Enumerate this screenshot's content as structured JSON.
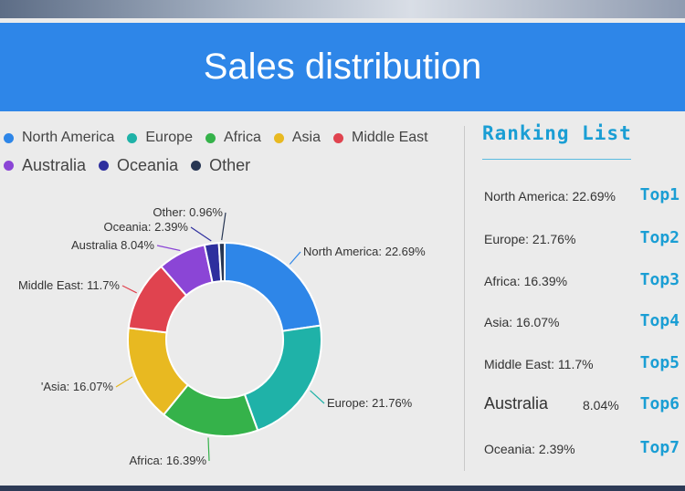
{
  "header": {
    "title": "Sales distribution"
  },
  "legend": {
    "row1": [
      {
        "name": "North America",
        "color": "#2e86e8"
      },
      {
        "name": "Europe",
        "color": "#1fb2a8"
      },
      {
        "name": "Africa",
        "color": "#35b24a"
      },
      {
        "name": "Asia",
        "color": "#e8b921"
      },
      {
        "name": "Middle East",
        "color": "#e0434f"
      }
    ],
    "row2": [
      {
        "name": "Australia",
        "color": "#8b45d6"
      },
      {
        "name": "Oceania",
        "color": "#2e2f9e"
      },
      {
        "name": "Other",
        "color": "#273653"
      }
    ]
  },
  "chart_data": {
    "type": "pie",
    "donut": true,
    "slices": [
      {
        "label": "North America",
        "value": 22.69,
        "display": "North America: 22.69%",
        "color": "#2e86e8"
      },
      {
        "label": "Europe",
        "value": 21.76,
        "display": "Europe: 21.76%",
        "color": "#1fb2a8"
      },
      {
        "label": "Africa",
        "value": 16.39,
        "display": "Africa: 16.39%",
        "color": "#35b24a"
      },
      {
        "label": "Asia",
        "value": 16.07,
        "display": "'Asia: 16.07%",
        "color": "#e8b921"
      },
      {
        "label": "Middle East",
        "value": 11.7,
        "display": "Middle East: 11.7%",
        "color": "#e0434f"
      },
      {
        "label": "Australia",
        "value": 8.04,
        "display": "Australia 8.04%",
        "color": "#8b45d6"
      },
      {
        "label": "Oceania",
        "value": 2.39,
        "display": "Oceania: 2.39%",
        "color": "#2e2f9e"
      },
      {
        "label": "Other",
        "value": 0.96,
        "display": "Other: 0.96%",
        "color": "#273653"
      }
    ]
  },
  "ranking": {
    "title": "Ranking List",
    "items": [
      {
        "text": "North America: 22.69%",
        "badge": "Top1"
      },
      {
        "text": "Europe: 21.76%",
        "badge": "Top2"
      },
      {
        "text": "Africa: 16.39%",
        "badge": "Top3"
      },
      {
        "text": "Asia: 16.07%",
        "badge": "Top4"
      },
      {
        "text": "Middle East: 11.7%",
        "badge": "Top5"
      },
      {
        "label": "Australia",
        "value": "8.04%",
        "badge": "Top6"
      },
      {
        "text": "Oceania: 2.39%",
        "badge": "Top7"
      }
    ]
  }
}
